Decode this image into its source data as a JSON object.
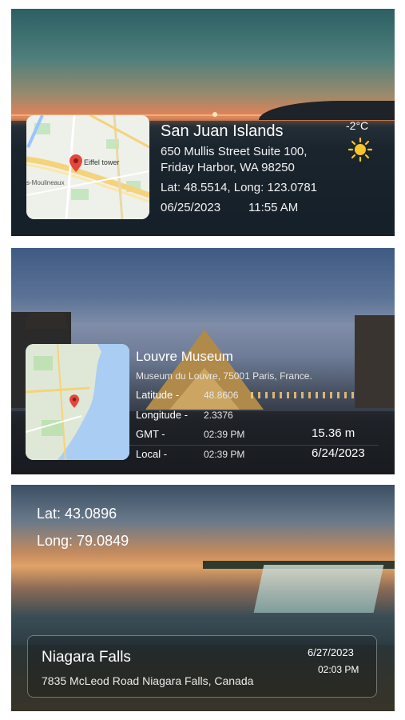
{
  "cards": [
    {
      "map_label": "Eiffel tower",
      "map_place": "s-Moulineaux",
      "title": "San Juan Islands",
      "address_line1": "650 Mullis Street Suite 100,",
      "address_line2": "Friday Harbor, WA 98250",
      "latlong": "Lat: 48.5514, Long: 123.0781",
      "date": "06/25/2023",
      "time": "11:55 AM",
      "temperature": "-2°C",
      "weather_icon": "sun-icon"
    },
    {
      "title": "Louvre Museum",
      "address": "Museum du Louvre, 75001 Paris, France.",
      "rows": [
        {
          "label": "Latitude -",
          "value": "48.8606"
        },
        {
          "label": "Longitude -",
          "value": "2.3376"
        },
        {
          "label": "GMT -",
          "value": "02:39 PM"
        },
        {
          "label": "Local -",
          "value": "02:39 PM"
        }
      ],
      "altitude": "15.36 m",
      "date": "6/24/2023"
    },
    {
      "lat": "Lat: 43.0896",
      "long": "Long: 79.0849",
      "title": "Niagara Falls",
      "address": "7835 McLeod Road Niagara Falls, Canada",
      "date": "6/27/2023",
      "time": "02:03 PM"
    }
  ],
  "colors": {
    "map_pin": "#e5463c",
    "sun": "#f7c52b"
  }
}
